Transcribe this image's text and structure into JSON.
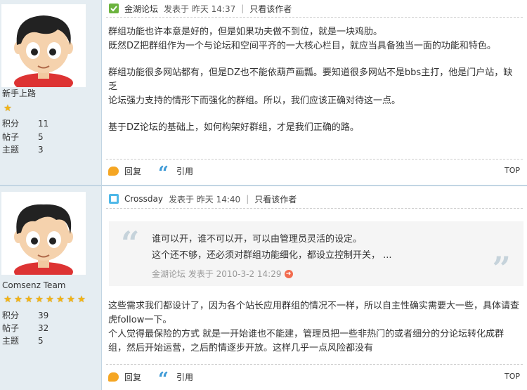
{
  "posts": [
    {
      "author": "金湖论坛",
      "posted": "发表于 昨天 14:37",
      "only_author": "只看该作者",
      "user_title": "新手上路",
      "stats": [
        {
          "label": "积分",
          "value": "11"
        },
        {
          "label": "帖子",
          "value": "5"
        },
        {
          "label": "主题",
          "value": "3"
        }
      ],
      "paragraphs": [
        [
          "群组功能也许本意是好的，但是如果功夫做不到位，就是一块鸡肋。",
          "既然DZ把群组作为一个与论坛和空间平齐的一大核心栏目，就应当具备独当一面的功能和特色。"
        ],
        [
          "群组功能很多网站都有，但是DZ也不能依葫芦画瓢。要知道很多网站不是bbs主打，他是门户站，缺乏",
          "论坛强力支持的情形下而强化的群组。所以，我们应该正确对待这一点。"
        ],
        [
          "基于DZ论坛的基础上，如何构架好群组，才是我们正确的路。"
        ]
      ],
      "reply_label": "回复",
      "quote_label": "引用",
      "top_label": "TOP"
    },
    {
      "author": "Crossday",
      "posted": "发表于 昨天 14:40",
      "only_author": "只看该作者",
      "user_title": "Comsenz Team",
      "stats": [
        {
          "label": "积分",
          "value": "39"
        },
        {
          "label": "帖子",
          "value": "32"
        },
        {
          "label": "主题",
          "value": "5"
        }
      ],
      "quote": {
        "lines": [
          "谁可以开，谁不可以开，可以由管理员灵活的设定。",
          "这个还不够，还必须对群组功能细化，都设立控制开关，   ..."
        ],
        "meta": "金湖论坛 发表于 2010-3-2 14:29"
      },
      "paragraphs": [
        [
          "这些需求我们都设计了，因为各个站长应用群组的情况不一样，所以自主性确实需要大一些，具体请查",
          "虎follow一下。",
          "个人觉得最保险的方式 就是一开始谁也不能建，管理员把一些非热门的或者细分的分论坛转化成群",
          "组，然后开始运营，之后酌情逐步开放。这样几乎一点风险都没有"
        ]
      ],
      "reply_label": "回复",
      "quote_label": "引用",
      "top_label": "TOP"
    }
  ],
  "colors": {
    "accent_link": "#336699",
    "sidebar_bg": "#e5edf2",
    "star": "#f3b413"
  }
}
